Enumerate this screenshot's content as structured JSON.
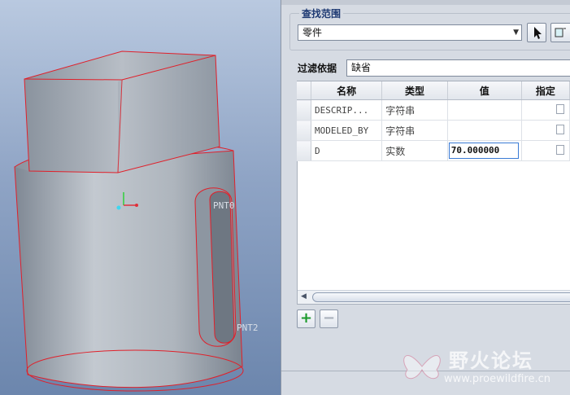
{
  "viewport": {
    "points": [
      "PNT0",
      "PNT2"
    ]
  },
  "panel": {
    "search_scope": {
      "legend": "查找范围",
      "selected": "零件"
    },
    "filter": {
      "label": "过滤依据",
      "selected": "缺省"
    },
    "table": {
      "columns": [
        "名称",
        "类型",
        "值",
        "指定"
      ],
      "rows": [
        {
          "name": "DESCRIP...",
          "type": "字符串",
          "value": ""
        },
        {
          "name": "MODELED_BY",
          "type": "字符串",
          "value": ""
        },
        {
          "name": "D",
          "type": "实数",
          "value": "70.000000"
        }
      ]
    },
    "buttons": {
      "add": "+",
      "remove": "−"
    }
  },
  "watermark": {
    "title": "野火论坛",
    "url": "www.proewildfire.cn"
  },
  "colors": {
    "accent_blue": "#1e3a73",
    "model_edge": "#e0202a",
    "add_green": "#1a9a2a"
  }
}
